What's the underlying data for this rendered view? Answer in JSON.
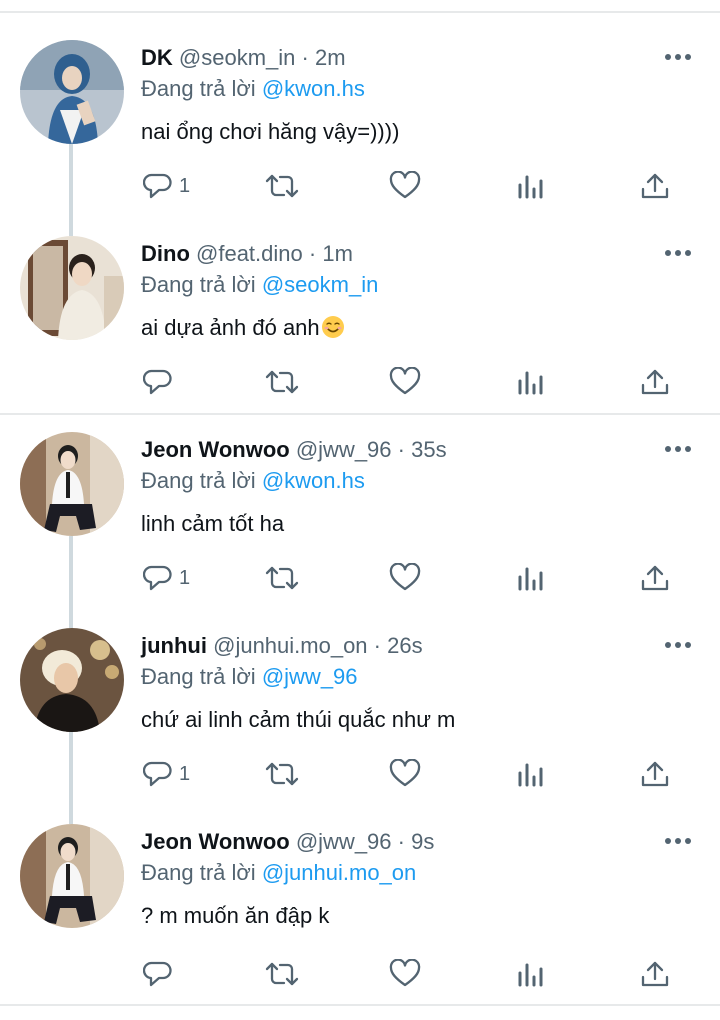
{
  "replying_label": "Đang trả lời",
  "tweets": [
    {
      "display_name": "DK",
      "handle": "@seokm_in",
      "sep": "·",
      "time": "2m",
      "reply_to": "@kwon.hs",
      "text": "nai ổng chơi hăng vậy=))))",
      "reply_count": "1",
      "avatar_icon": "avatar-dk"
    },
    {
      "display_name": "Dino",
      "handle": "@feat.dino",
      "sep": "·",
      "time": "1m",
      "reply_to": "@seokm_in",
      "text": "ai dựa ảnh đó anh",
      "reply_count": "",
      "avatar_icon": "avatar-dino"
    },
    {
      "display_name": "Jeon Wonwoo",
      "handle": "@jww_96",
      "sep": "·",
      "time": "35s",
      "reply_to": "@kwon.hs",
      "text": "linh cảm tốt ha",
      "reply_count": "1",
      "avatar_icon": "avatar-wonwoo"
    },
    {
      "display_name": "junhui",
      "handle": "@junhui.mo_on",
      "sep": "·",
      "time": "26s",
      "reply_to": "@jww_96",
      "text": "chứ ai linh cảm thúi quắc như m",
      "reply_count": "1",
      "avatar_icon": "avatar-junhui"
    },
    {
      "display_name": "Jeon Wonwoo",
      "handle": "@jww_96",
      "sep": "·",
      "time": "9s",
      "reply_to": "@junhui.mo_on",
      "text": "? m muốn ăn đập k",
      "reply_count": "",
      "avatar_icon": "avatar-wonwoo"
    }
  ],
  "colors": {
    "accent": "#1d9bf0",
    "secondary_text": "#536471",
    "icon": "#536471",
    "divider": "#e7e9ea",
    "thread_line": "#cfd9de"
  }
}
